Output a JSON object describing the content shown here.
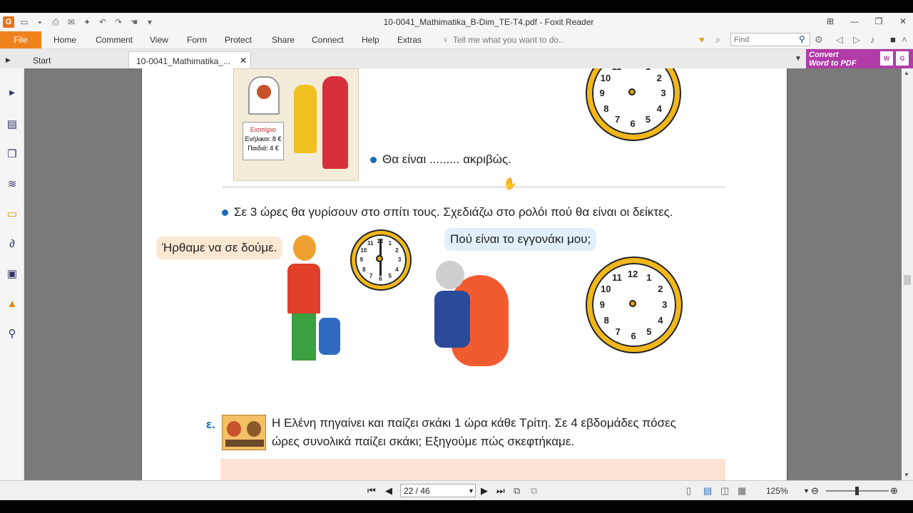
{
  "window": {
    "title": "10-0041_Mathimatika_B-Dim_TE-T4.pdf - Foxit Reader",
    "app_logo": "G"
  },
  "menu": {
    "file": "File",
    "items": [
      "Home",
      "Comment",
      "View",
      "Form",
      "Protect",
      "Share",
      "Connect",
      "Help",
      "Extras"
    ],
    "tell_me": "Tell me what you want to do..",
    "find_placeholder": "Find"
  },
  "tabs": {
    "start": "Start",
    "doc": "10-0041_Mathimatika_...",
    "convert_line1": "Convert",
    "convert_line2": "Word to PDF"
  },
  "document": {
    "ticket_title": "Εισιτήριο",
    "ticket_adults": "Ενήλικοι: 8 €",
    "ticket_children": "Παιδιά: 4 €",
    "line_exactly": "Θα είναι ......... ακριβώς.",
    "line_3hours": "Σε 3 ώρες θα γυρίσουν στο σπίτι τους. Σχεδιάζω στο ρολόι πού θα είναι οι δείκτες.",
    "bubble_came": "Ήρθαμε να σε δούμε.",
    "bubble_grandchild": "Πού είναι το εγγονάκι μου;",
    "section_letter": "ε.",
    "chess_line1": "Η Ελένη πηγαίνει και παίζει σκάκι 1 ώρα κάθε Τρίτη. Σε 4 εβδομάδες πόσες",
    "chess_line2": "ώρες συνολικά παίζει σκάκι; Εξηγούμε πώς σκεφτήκαμε.",
    "clock_numbers": [
      "12",
      "1",
      "2",
      "3",
      "4",
      "5",
      "6",
      "7",
      "8",
      "9",
      "10",
      "11"
    ]
  },
  "statusbar": {
    "page_value": "22 / 46",
    "zoom": "125%"
  },
  "colors": {
    "accent": "#f0821e",
    "convert": "#b23ba8",
    "clock_rim": "#f2b71a",
    "bullet": "#1e6bb8"
  }
}
